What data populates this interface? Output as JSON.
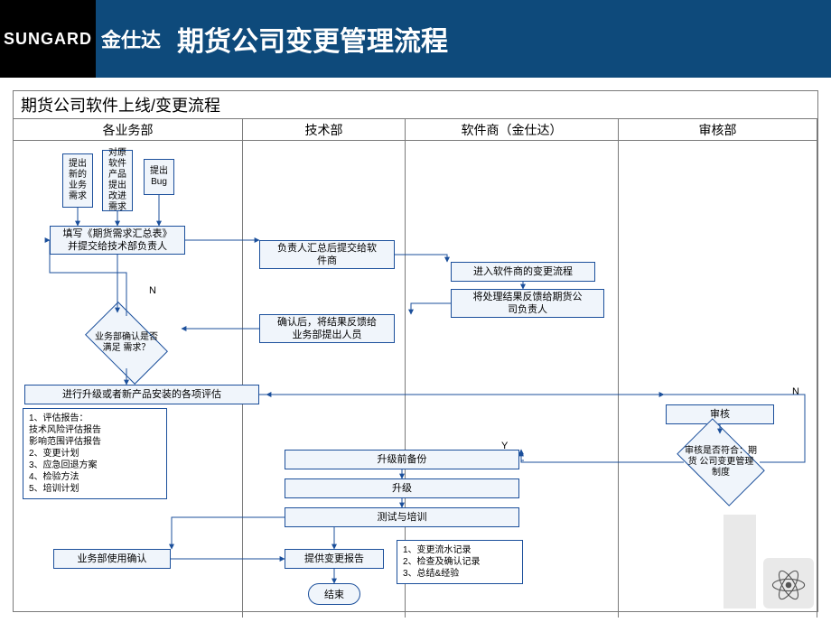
{
  "header": {
    "logo": "SUNGARD",
    "brand": "金仕达",
    "title": "期货公司变更管理流程"
  },
  "diagram": {
    "title": "期货公司软件上线/变更流程",
    "lanes": {
      "l1": "各业务部",
      "l2": "技术部",
      "l3": "软件商（金仕达）",
      "l4": "审核部"
    },
    "nodes": {
      "a1": "提出\n新的\n业务\n需求",
      "a2": "对原\n软件\n产品\n提出\n改进\n需求",
      "a3": "提出\nBug",
      "a4": "填写《期货需求汇总表》\n并提交给技术部负责人",
      "a5": "业务部确认是否满足\n需求？",
      "a6": "进行升级或者新产品安装的各项评估",
      "a7": "业务部使用确认",
      "b1": "负责人汇总后提交给软\n件商",
      "b2": "确认后，将结果反馈给\n业务部提出人员",
      "b3": "升级前备份",
      "b4": "升级",
      "b5": "测试与培训",
      "b6": "提供变更报告",
      "b7": "结束",
      "c1": "进入软件商的变更流程",
      "c2": "将处理结果反馈给期货公\n司负责人",
      "d1": "审核",
      "d2": "审核是否符合：期货\n公司变更管理制度"
    },
    "notes": {
      "n1": "1、评估报告：\n技术风险评估报告\n影响范围评估报告\n2、变更计划\n3、应急回退方案\n4、检验方法\n5、培训计划",
      "n2": "1、变更流水记录\n2、检查及确认记录\n3、总结&经验"
    },
    "labels": {
      "labelN1": "N",
      "labelN2": "N",
      "labelY": "Y"
    }
  }
}
